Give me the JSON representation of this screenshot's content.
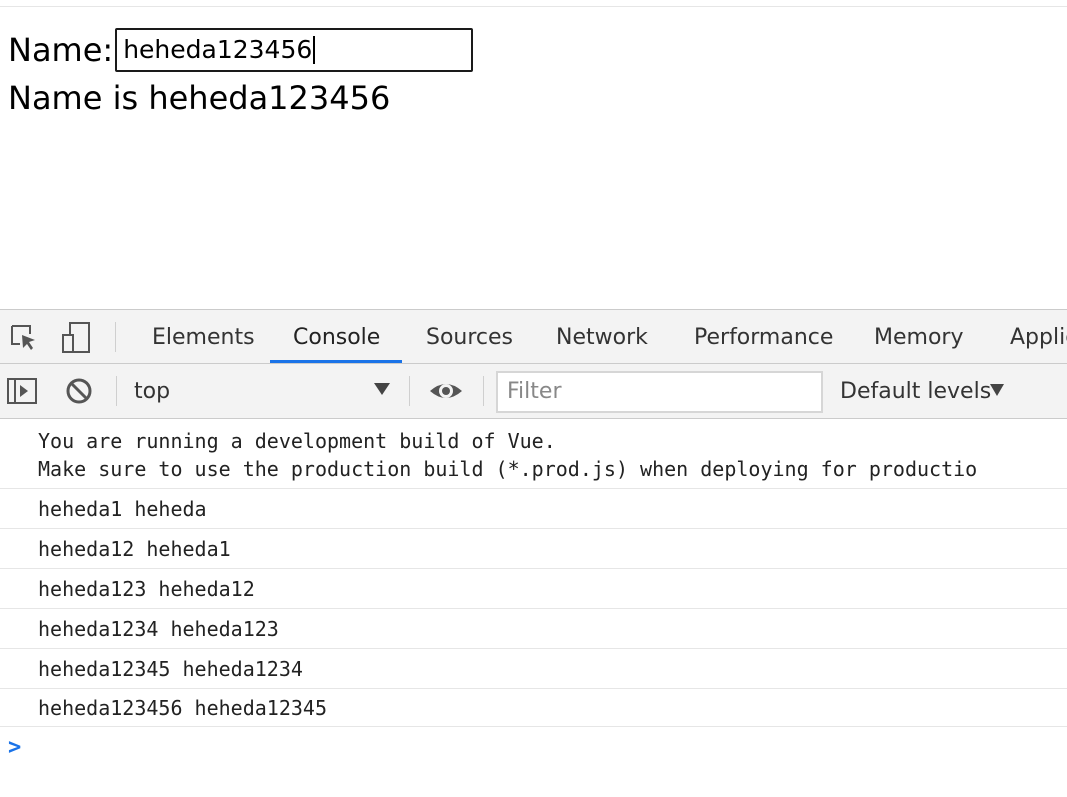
{
  "app": {
    "name_label": "Name:",
    "name_value": "heheda123456",
    "name_output": "Name is heheda123456"
  },
  "devtools": {
    "tabs": [
      {
        "label": "Elements"
      },
      {
        "label": "Console"
      },
      {
        "label": "Sources"
      },
      {
        "label": "Network"
      },
      {
        "label": "Performance"
      },
      {
        "label": "Memory"
      },
      {
        "label": "Applic"
      }
    ],
    "active_tab": "Console",
    "toolbar": {
      "context": "top",
      "filter_placeholder": "Filter",
      "levels": "Default levels"
    },
    "messages": [
      {
        "lines": [
          "You are running a development build of Vue.",
          "Make sure to use the production build (*.prod.js) when deploying for productio"
        ]
      },
      {
        "lines": [
          "heheda1 heheda"
        ]
      },
      {
        "lines": [
          "heheda12 heheda1"
        ]
      },
      {
        "lines": [
          "heheda123 heheda12"
        ]
      },
      {
        "lines": [
          "heheda1234 heheda123"
        ]
      },
      {
        "lines": [
          "heheda12345 heheda1234"
        ]
      },
      {
        "lines": [
          "heheda123456 heheda12345"
        ]
      }
    ],
    "prompt_symbol": ">"
  },
  "colors": {
    "accent": "#1a73e8",
    "toolbar_bg": "#f3f3f3",
    "border": "#cbcbcb"
  }
}
